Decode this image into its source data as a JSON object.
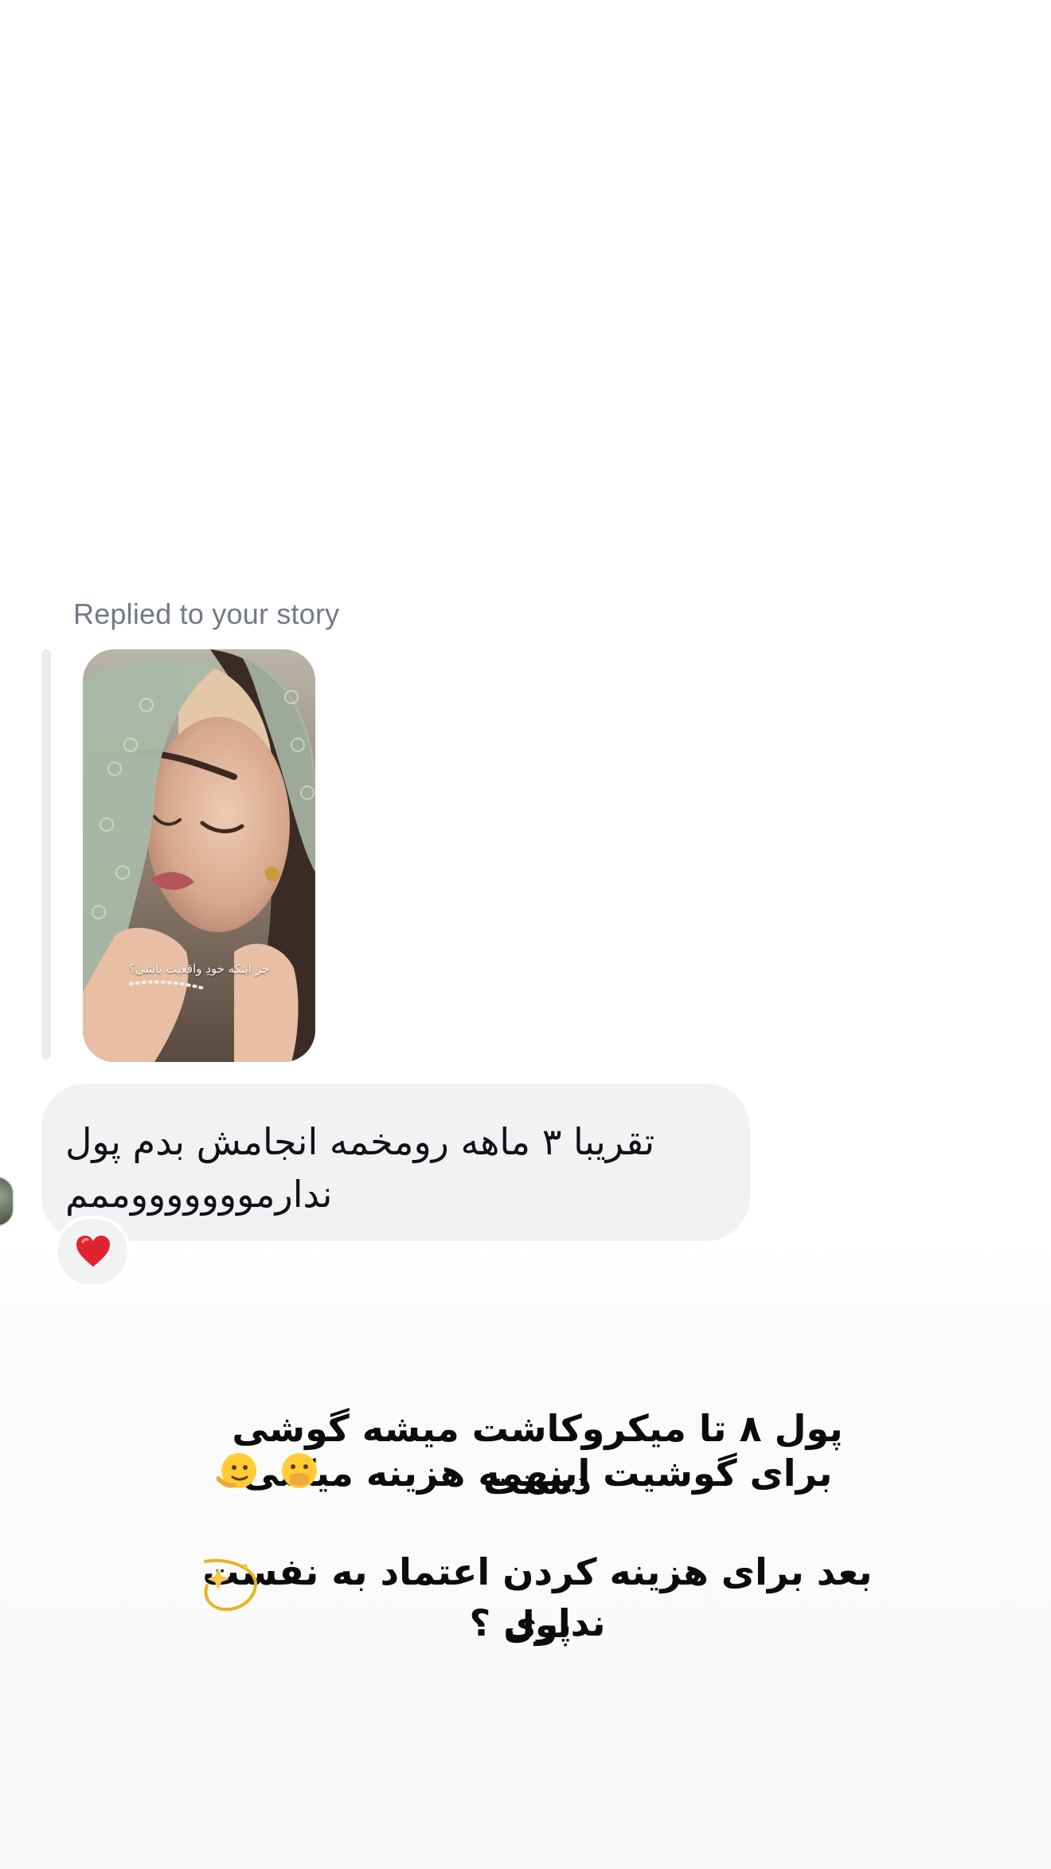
{
  "reply": {
    "label": "Replied to your story",
    "story_caption": "جز اینکه خودِ واقعیت باشی؟"
  },
  "message": {
    "line1": "تقریبا ۳ ماهه رومخمه انجامش بدم پول",
    "line2": "ندارموووووووممم",
    "reaction": "heart"
  },
  "story_overlay": {
    "line1": "پول ۸ تا میکروکاشت میشه گوشی دستت",
    "line2": "برای گوشیت اینهمه هزینه میکنی",
    "line3": "بعد برای هزینه کردن اعتماد به نفست پول",
    "line4": "نداری ؟"
  },
  "colors": {
    "bubble": "#f1f2f4",
    "label": "#737a85",
    "heart": "#e0242f"
  }
}
